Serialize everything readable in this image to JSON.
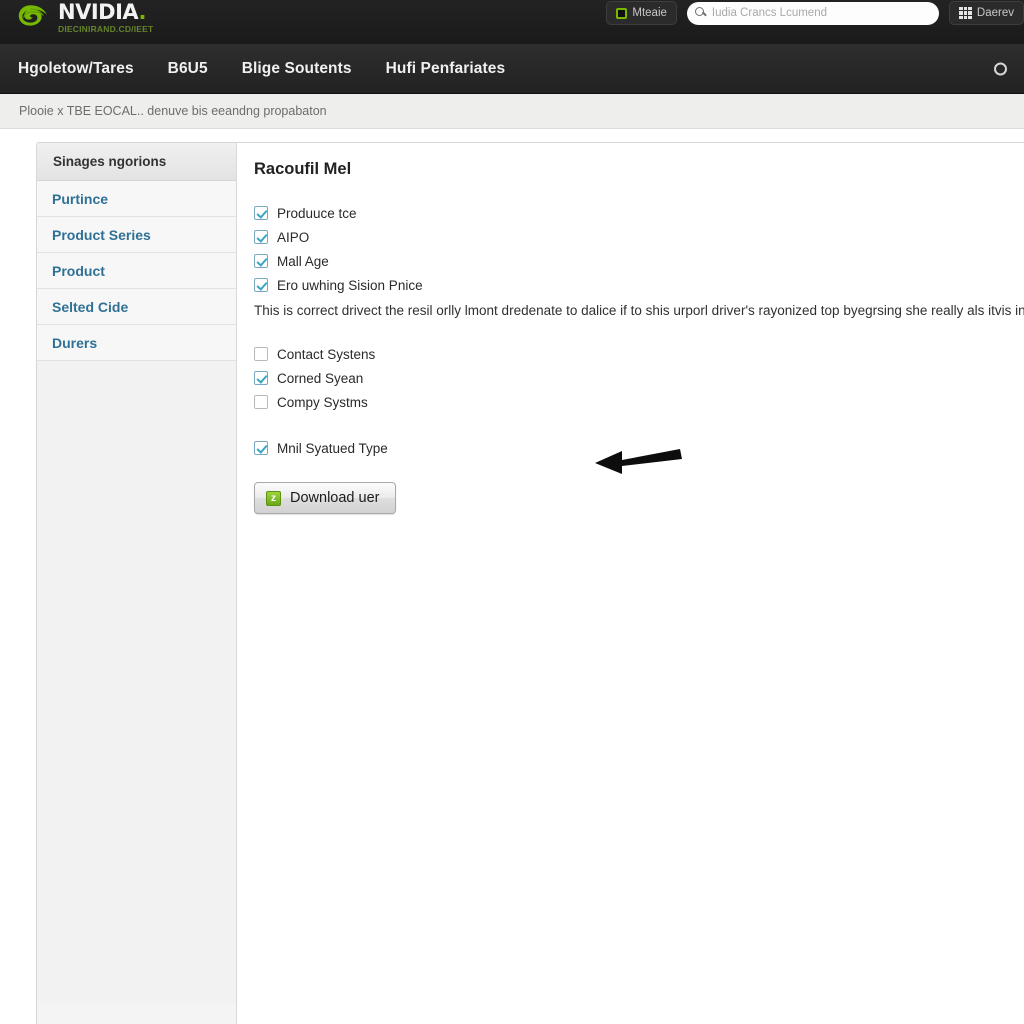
{
  "topbar": {
    "logo_word": "NVIDIA",
    "logo_dot": ".",
    "logo_sub": "DIECINIRAND.CD/IEET",
    "logo_eye_icon": "nvidia-eye-logo",
    "mode_button_label": "Mteaie",
    "mode_button_icon": "square-outline-icon",
    "search_placeholder": "Iudia Crancs Lcumend",
    "search_icon": "search-icon",
    "apps_button_label": "Daerev",
    "apps_button_icon": "grid-apps-icon"
  },
  "nav": {
    "items": [
      {
        "label": "Hgoletow/Tares"
      },
      {
        "label": "B6U5"
      },
      {
        "label": "Blige Soutents"
      },
      {
        "label": "Hufi Penfariates"
      }
    ],
    "right_icon": "circle-icon"
  },
  "subbar": {
    "text": "Plooie x TBE EOCAL.. denuve bis eeandng propabaton"
  },
  "sidebar": {
    "header": "Sinages ngorions",
    "items": [
      {
        "label": "Purtince"
      },
      {
        "label": "Product Series"
      },
      {
        "label": "Product"
      },
      {
        "label": "Selted Cide"
      },
      {
        "label": "Durers"
      }
    ]
  },
  "content": {
    "title": "Racoufil Mel",
    "group_one": [
      {
        "label": "Produuce tce",
        "checked": true
      },
      {
        "label": "AIPO",
        "checked": true
      },
      {
        "label": "Mall Age",
        "checked": true
      },
      {
        "label": "Ero uwhing Sision Pnice",
        "checked": true
      }
    ],
    "description": "This is correct drivect the resil orlly lmont dredenate to dalice if to shis urporl driver's rayonized top byegrsing she really als itvis in.",
    "group_two": [
      {
        "label": "Contact Systens",
        "checked": false
      },
      {
        "label": "Corned Syean",
        "checked": true
      },
      {
        "label": "Compy Systms",
        "checked": false
      }
    ],
    "group_three": [
      {
        "label": "Mnil Syatued Type",
        "checked": true
      }
    ],
    "download_button": {
      "label": "Download uer",
      "icon": "download-archive-icon"
    },
    "annotation_icon": "left-arrow-annotation"
  },
  "colors": {
    "nvidia_green": "#76b900",
    "link_blue": "#2f7196",
    "checkbox_check": "#35a6c4",
    "topbar_dark": "#1e1e1e",
    "navbar_dark": "#272727"
  }
}
